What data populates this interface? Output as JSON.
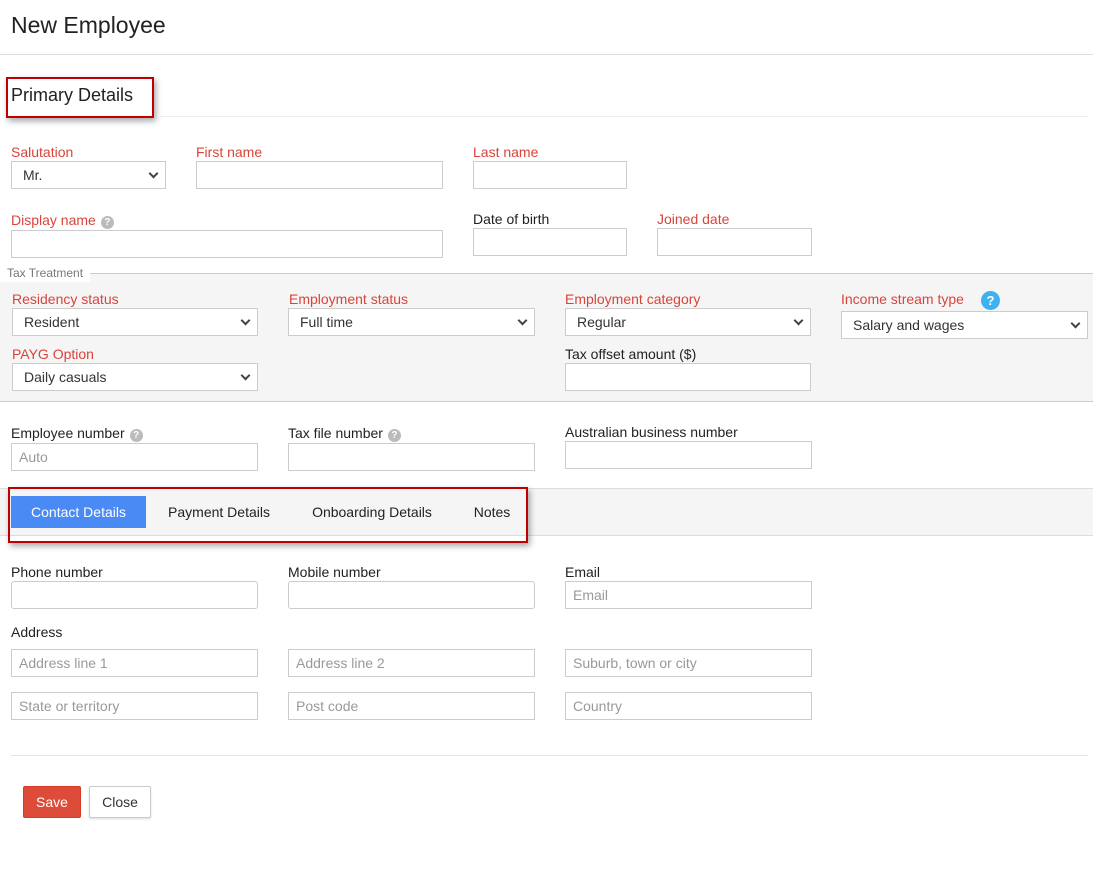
{
  "title": "New Employee",
  "section_title": "Primary Details",
  "primary": {
    "salutation": {
      "label": "Salutation",
      "value": "Mr."
    },
    "first_name": {
      "label": "First name",
      "value": ""
    },
    "last_name": {
      "label": "Last name",
      "value": ""
    },
    "display_name": {
      "label": "Display name",
      "value": ""
    },
    "date_of_birth": {
      "label": "Date of birth",
      "value": ""
    },
    "joined_date": {
      "label": "Joined date",
      "value": ""
    }
  },
  "tax": {
    "legend": "Tax Treatment",
    "residency_status": {
      "label": "Residency status",
      "value": "Resident"
    },
    "employment_status": {
      "label": "Employment status",
      "value": "Full time"
    },
    "employment_category": {
      "label": "Employment category",
      "value": "Regular"
    },
    "income_stream_type": {
      "label": "Income stream type",
      "value": "Salary and wages"
    },
    "payg_option": {
      "label": "PAYG Option",
      "value": "Daily casuals"
    },
    "tax_offset": {
      "label": "Tax offset amount ($)",
      "value": ""
    }
  },
  "ids": {
    "employee_number": {
      "label": "Employee number",
      "placeholder": "Auto"
    },
    "tax_file_number": {
      "label": "Tax file number",
      "placeholder": ""
    },
    "abn": {
      "label": "Australian business number",
      "placeholder": ""
    }
  },
  "tabs": [
    {
      "label": "Contact Details",
      "active": true
    },
    {
      "label": "Payment Details"
    },
    {
      "label": "Onboarding Details"
    },
    {
      "label": "Notes"
    }
  ],
  "contact": {
    "phone": {
      "label": "Phone number"
    },
    "mobile": {
      "label": "Mobile number"
    },
    "email": {
      "label": "Email",
      "placeholder": "Email"
    },
    "address_label": "Address",
    "address1": "Address line 1",
    "address2": "Address line 2",
    "suburb": "Suburb, town or city",
    "state": "State or territory",
    "postcode": "Post code",
    "country": "Country"
  },
  "buttons": {
    "save": "Save",
    "close": "Close"
  },
  "colors": {
    "required": "#d9443a",
    "tab_active": "#4a8af4",
    "save": "#dd4b39",
    "help": "#3eb1f0"
  }
}
